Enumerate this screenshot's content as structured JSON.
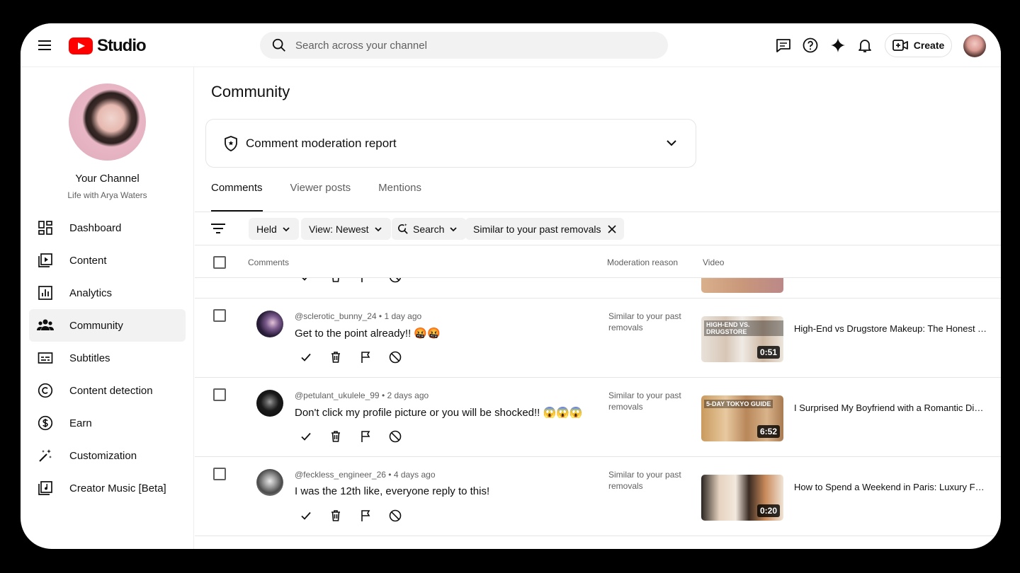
{
  "header": {
    "logo_text": "Studio",
    "search_placeholder": "Search across your channel",
    "create_label": "Create"
  },
  "channel": {
    "name": "Your Channel",
    "subtitle": "Life with Arya Waters"
  },
  "nav": [
    {
      "label": "Dashboard",
      "icon": "dashboard-icon"
    },
    {
      "label": "Content",
      "icon": "content-icon"
    },
    {
      "label": "Analytics",
      "icon": "analytics-icon"
    },
    {
      "label": "Community",
      "icon": "community-icon",
      "active": true
    },
    {
      "label": "Subtitles",
      "icon": "subtitles-icon"
    },
    {
      "label": "Content detection",
      "icon": "copyright-icon"
    },
    {
      "label": "Earn",
      "icon": "dollar-icon"
    },
    {
      "label": "Customization",
      "icon": "magic-wand-icon"
    },
    {
      "label": "Creator Music [Beta]",
      "icon": "music-icon"
    }
  ],
  "main": {
    "title": "Community",
    "report_label": "Comment moderation report",
    "tabs": [
      "Comments",
      "Viewer posts",
      "Mentions"
    ],
    "filters": {
      "held": "Held",
      "view": "View: Newest",
      "search": "Search",
      "similar": "Similar to your past removals"
    },
    "columns": {
      "comments": "Comments",
      "reason": "Moderation reason",
      "video": "Video"
    }
  },
  "comments": [
    {
      "user": "@sclerotic_bunny_24",
      "time": "1 day ago",
      "text": "Get to the point already!! 🤬🤬",
      "reason": "Similar to your past removals",
      "duration": "0:51",
      "thumb_caption": "HIGH-END VS. DRUGSTORE",
      "video_title": "High-End vs Drugstore Makeup: The Honest Truth"
    },
    {
      "user": "@petulant_ukulele_99",
      "time": "2 days ago",
      "text": "Don't click my profile picture or you will be shocked!! 😱😱😱",
      "reason": "Similar to your past removals",
      "duration": "6:52",
      "thumb_caption": "5-DAY TOKYO GUIDE",
      "video_title": "I Surprised My Boyfriend with a Romantic Dinner"
    },
    {
      "user": "@feckless_engineer_26",
      "time": "4 days ago",
      "text": "I was the 12th like, everyone reply to this!",
      "reason": "Similar to your past removals",
      "duration": "0:20",
      "thumb_caption": "",
      "video_title": "How to Spend a Weekend in Paris: Luxury Fashion"
    }
  ],
  "colors": {
    "brand_red": "#ff0000",
    "text_primary": "#0f0f0f",
    "text_secondary": "#606060",
    "chip_bg": "#f2f2f2"
  }
}
